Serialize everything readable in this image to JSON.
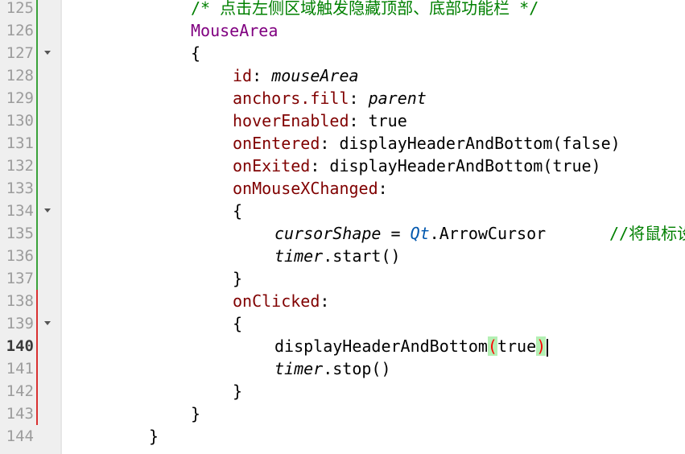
{
  "editor": {
    "lines": [
      {
        "num": "125",
        "text": "/* 点击左侧区域触发隐藏顶部、底部功能栏 */"
      },
      {
        "num": "126",
        "text": "MouseArea"
      },
      {
        "num": "127",
        "text": "{"
      },
      {
        "num": "128",
        "prop": "id",
        "sep": ": ",
        "val": "mouseArea"
      },
      {
        "num": "129",
        "prop": "anchors.fill",
        "sep": ": ",
        "val": "parent"
      },
      {
        "num": "130",
        "prop": "hoverEnabled",
        "sep": ": ",
        "val": "true"
      },
      {
        "num": "131",
        "prop": "onEntered",
        "sep": ": ",
        "val": "displayHeaderAndBottom(false)"
      },
      {
        "num": "132",
        "prop": "onExited",
        "sep": ": ",
        "val": "displayHeaderAndBottom(true)"
      },
      {
        "num": "133",
        "prop": "onMouseXChanged",
        "sep": ":"
      },
      {
        "num": "134",
        "text": "{"
      },
      {
        "num": "135",
        "var": "cursorShape",
        "op": " = ",
        "qt": "Qt",
        "rest": ".ArrowCursor",
        "comment": "//将鼠标设"
      },
      {
        "num": "136",
        "var": "timer",
        "rest": ".start()"
      },
      {
        "num": "137",
        "text": "}"
      },
      {
        "num": "138",
        "prop": "onClicked",
        "sep": ":"
      },
      {
        "num": "139",
        "text": "{"
      },
      {
        "num": "140",
        "fn": "displayHeaderAndBottom",
        "open": "(",
        "arg": "true",
        "close": ")"
      },
      {
        "num": "141",
        "var": "timer",
        "rest": ".stop()"
      },
      {
        "num": "142",
        "text": "}"
      },
      {
        "num": "143",
        "text": "}"
      },
      {
        "num": "144",
        "text": "}"
      }
    ]
  },
  "colors": {
    "comment": "#008000",
    "type": "#800080",
    "property": "#800000",
    "saved_marker": "#3aa23a",
    "unsaved_marker": "#d93030"
  }
}
